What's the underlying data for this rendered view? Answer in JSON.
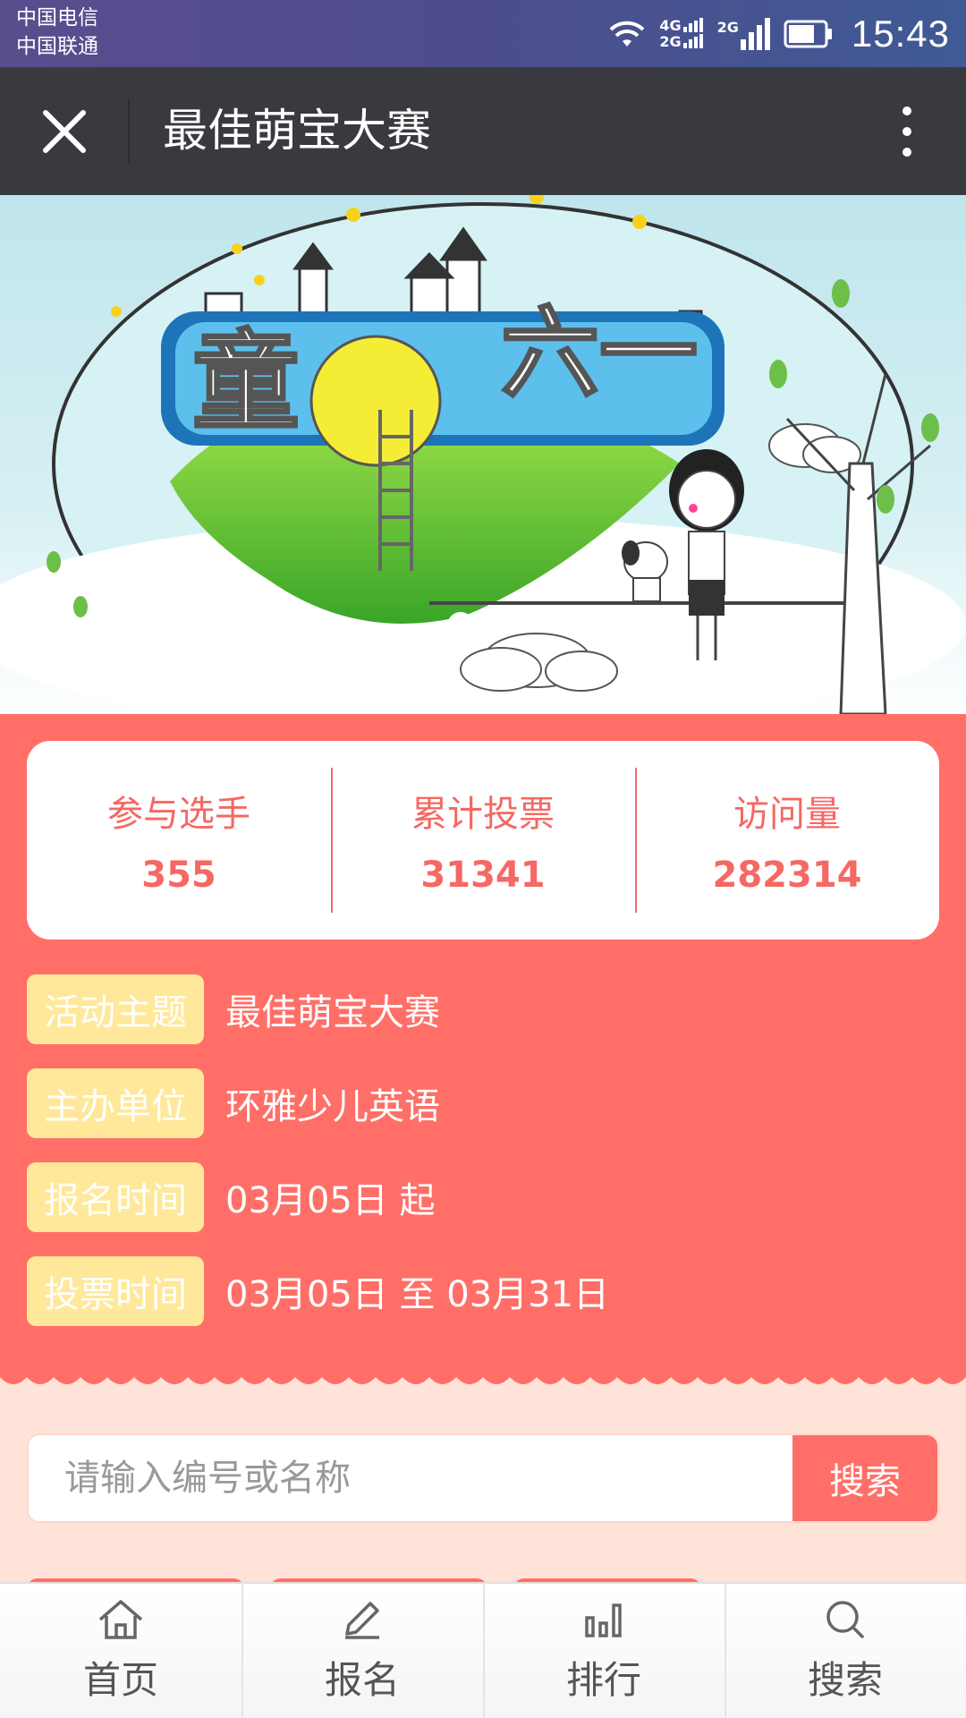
{
  "status_bar": {
    "carrier_1": "中国电信",
    "carrier_2": "中国联通",
    "net_1_top": "4G",
    "net_1_bottom": "2G",
    "net_2": "2G",
    "time": "15:43"
  },
  "title_bar": {
    "title": "最佳萌宝大赛"
  },
  "banner": {
    "slide_count": 2,
    "active_slide": 1
  },
  "stats": [
    {
      "label": "参与选手",
      "value": "355"
    },
    {
      "label": "累计投票",
      "value": "31341"
    },
    {
      "label": "访问量",
      "value": "282314"
    }
  ],
  "info": [
    {
      "tag": "活动主题",
      "value": "最佳萌宝大赛"
    },
    {
      "tag": "主办单位",
      "value": "环雅少儿英语"
    },
    {
      "tag": "报名时间",
      "value": "03月05日 起"
    },
    {
      "tag": "投票时间",
      "value": "03月05日 至 03月31日"
    }
  ],
  "search": {
    "placeholder": "请输入编号或名称",
    "button_label": "搜索"
  },
  "bottom_nav": [
    {
      "label": "首页",
      "icon": "home-icon"
    },
    {
      "label": "报名",
      "icon": "pencil-icon"
    },
    {
      "label": "排行",
      "icon": "bar-chart-icon"
    },
    {
      "label": "搜索",
      "icon": "search-icon"
    }
  ],
  "colors": {
    "accent": "#ff6f68",
    "tag_bg": "#ffe89a",
    "title_bar": "#393a3f"
  }
}
